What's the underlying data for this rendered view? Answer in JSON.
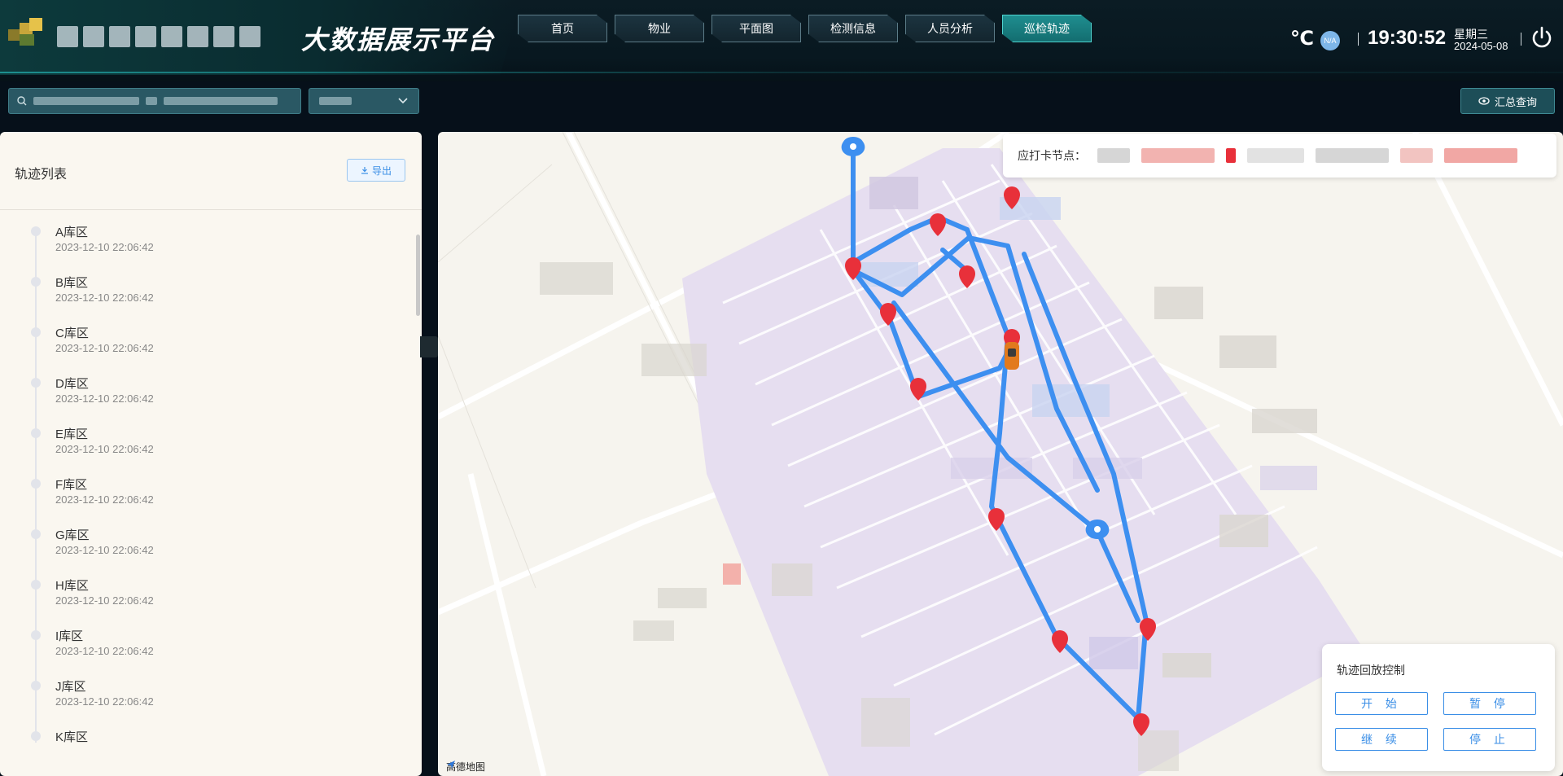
{
  "header": {
    "title": "大数据展示平台",
    "nav_tabs": [
      {
        "label": "首页",
        "active": false
      },
      {
        "label": "物业",
        "active": false
      },
      {
        "label": "平面图",
        "active": false
      },
      {
        "label": "检测信息",
        "active": false
      },
      {
        "label": "人员分析",
        "active": false
      },
      {
        "label": "巡检轨迹",
        "active": true
      }
    ],
    "weather_unit": "℃",
    "weather_badge": "N/A",
    "time": "19:30:52",
    "weekday": "星期三",
    "date": "2024-05-08",
    "power_icon": "power-icon"
  },
  "filter": {
    "search_icon": "search-icon",
    "select_arrow_icon": "chevron-down-icon",
    "summary_label": "汇总查询",
    "summary_icon": "eye-icon"
  },
  "track_panel": {
    "title": "轨迹列表",
    "export_label": "导出",
    "export_icon": "download-icon",
    "items": [
      {
        "name": "A库区",
        "time": "2023-12-10 22:06:42"
      },
      {
        "name": "B库区",
        "time": "2023-12-10 22:06:42"
      },
      {
        "name": "C库区",
        "time": "2023-12-10 22:06:42"
      },
      {
        "name": "D库区",
        "time": "2023-12-10 22:06:42"
      },
      {
        "name": "E库区",
        "time": "2023-12-10 22:06:42"
      },
      {
        "name": "F库区",
        "time": "2023-12-10 22:06:42"
      },
      {
        "name": "G库区",
        "time": "2023-12-10 22:06:42"
      },
      {
        "name": "H库区",
        "time": "2023-12-10 22:06:42"
      },
      {
        "name": "I库区",
        "time": "2023-12-10 22:06:42"
      },
      {
        "name": "J库区",
        "time": "2023-12-10 22:06:42"
      },
      {
        "name": "K库区",
        "time": ""
      }
    ]
  },
  "map": {
    "legend_label": "应打卡节点：",
    "credit": "高德地图",
    "colors": {
      "route": "#3d8ff0",
      "checkpoint": "#e8303a",
      "start_marker": "#3d8ff0",
      "zone": "#e6def0"
    }
  },
  "playback": {
    "title": "轨迹回放控制",
    "start": "开 始",
    "pause": "暂 停",
    "resume": "继 续",
    "stop": "停 止"
  }
}
